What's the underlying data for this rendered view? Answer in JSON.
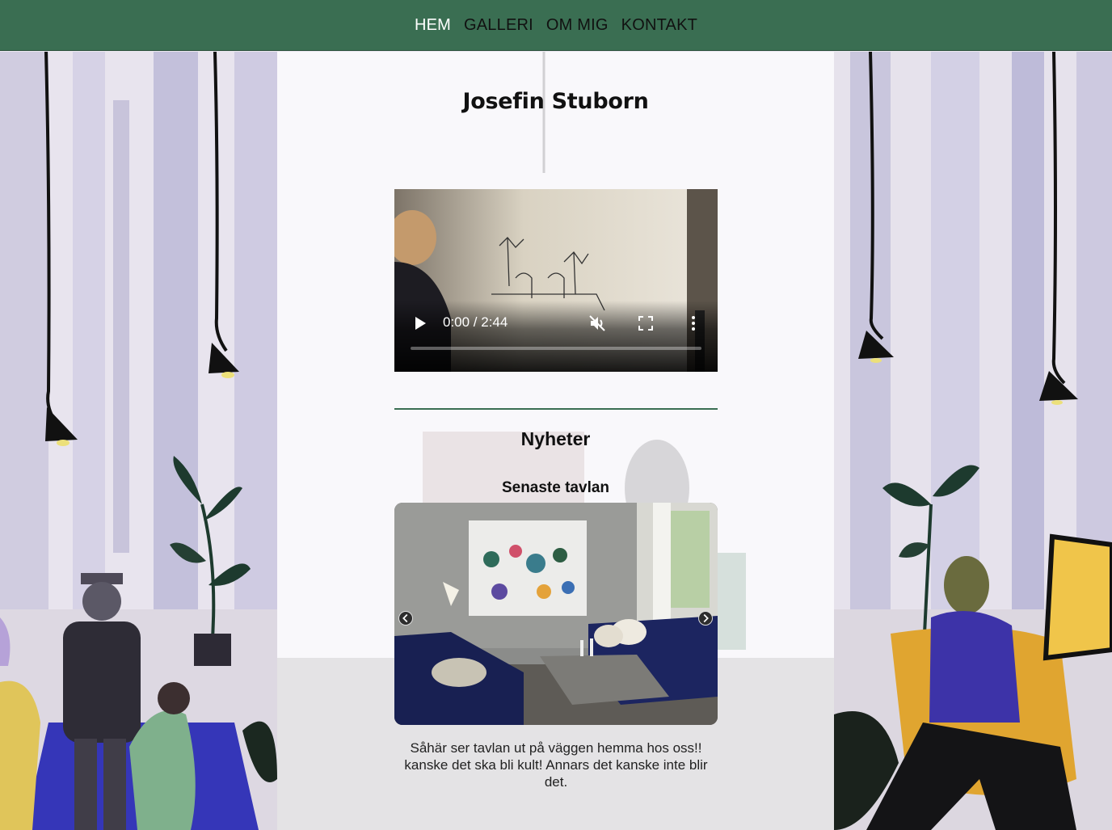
{
  "nav": {
    "items": [
      {
        "label": "HEM",
        "active": true
      },
      {
        "label": "GALLERI",
        "active": false
      },
      {
        "label": "OM MIG",
        "active": false
      },
      {
        "label": "KONTAKT",
        "active": false
      }
    ]
  },
  "site": {
    "title": "Josefin Stuborn"
  },
  "video": {
    "time": "0:00 / 2:44",
    "muted": true,
    "progress": 0
  },
  "news": {
    "heading": "Nyheter",
    "subheading": "Senaste tavlan",
    "caption": "Såhär ser tavlan ut på väggen hemma hos oss!! kanske det ska bli kult! Annars det kanske inte blir det."
  },
  "colors": {
    "nav_bg": "#3a6e52",
    "accent": "#3a6e52",
    "active_link": "#ffffff"
  },
  "icons": {
    "play": "play-icon",
    "mute": "muted-speaker-icon",
    "fullscreen": "fullscreen-icon",
    "more": "kebab-menu-icon",
    "prev": "chevron-left-icon",
    "next": "chevron-right-icon"
  }
}
